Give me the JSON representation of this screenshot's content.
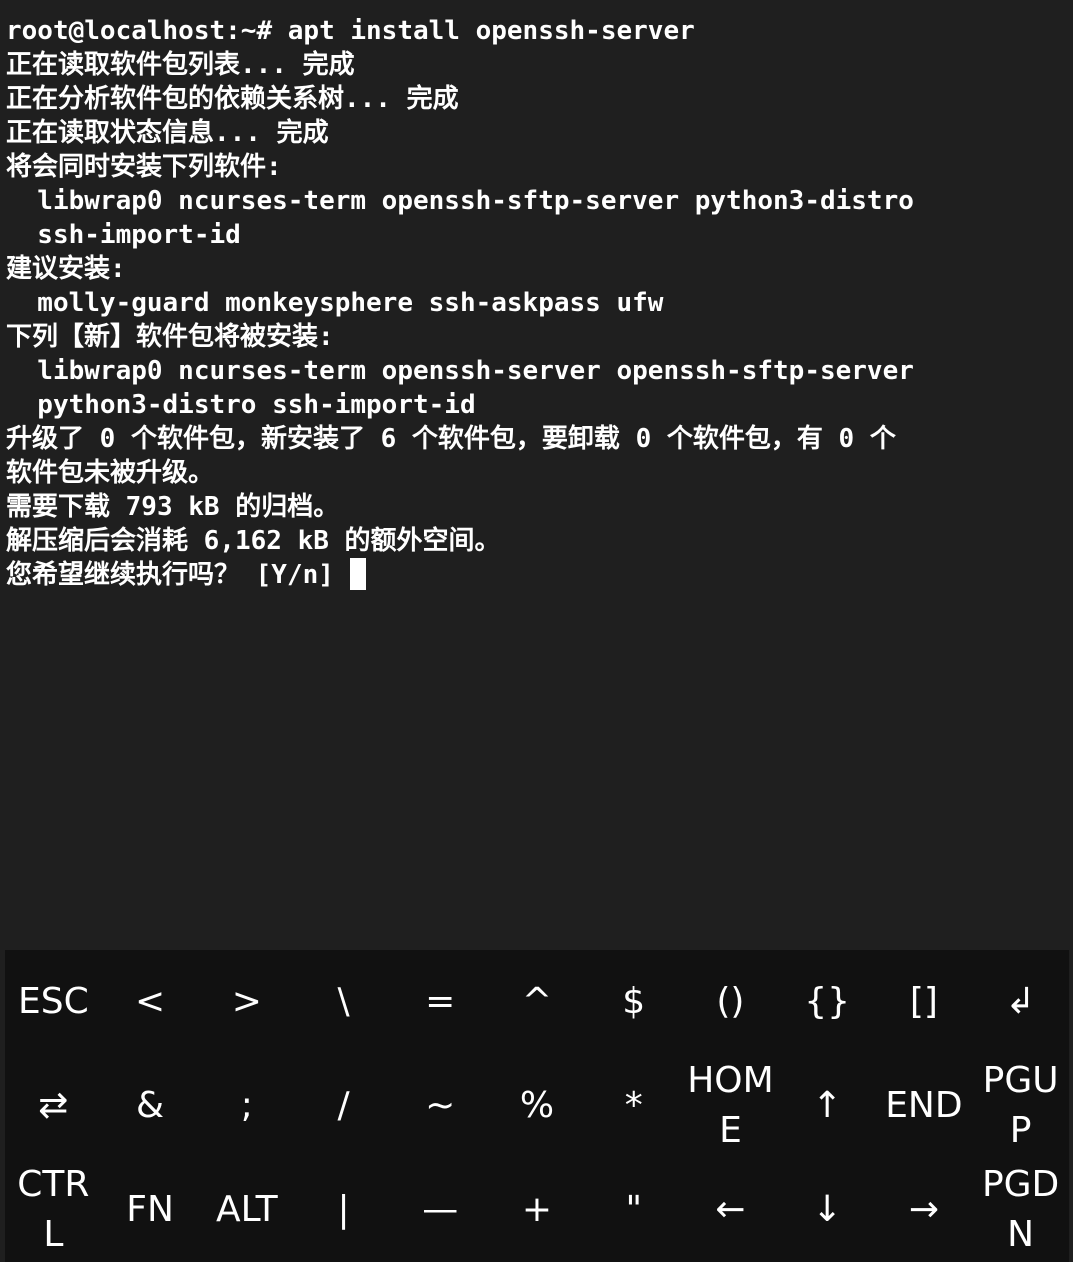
{
  "terminal": {
    "lines": [
      "root@localhost:~# apt install openssh-server",
      "正在读取软件包列表... 完成",
      "正在分析软件包的依赖关系树... 完成",
      "正在读取状态信息... 完成",
      "将会同时安装下列软件:",
      "  libwrap0 ncurses-term openssh-sftp-server python3-distro",
      "  ssh-import-id",
      "建议安装:",
      "  molly-guard monkeysphere ssh-askpass ufw",
      "下列【新】软件包将被安装:",
      "  libwrap0 ncurses-term openssh-server openssh-sftp-server",
      "  python3-distro ssh-import-id",
      "升级了 0 个软件包，新安装了 6 个软件包，要卸载 0 个软件包，有 0 个",
      "软件包未被升级。",
      "需要下载 793 kB 的归档。",
      "解压缩后会消耗 6,162 kB 的额外空间。"
    ],
    "prompt": "您希望继续执行吗？ [Y/n] "
  },
  "keyboard": {
    "rows": [
      [
        {
          "name": "key-esc",
          "label": "ESC"
        },
        {
          "name": "key-less-than",
          "label": "<"
        },
        {
          "name": "key-greater-than",
          "label": ">"
        },
        {
          "name": "key-backslash",
          "label": "\\"
        },
        {
          "name": "key-equals",
          "label": "="
        },
        {
          "name": "key-caret",
          "label": "^"
        },
        {
          "name": "key-dollar",
          "label": "$"
        },
        {
          "name": "key-parentheses",
          "label": "()"
        },
        {
          "name": "key-braces",
          "label": "{}"
        },
        {
          "name": "key-brackets",
          "label": "[]"
        },
        {
          "name": "key-enter",
          "label": "↲"
        }
      ],
      [
        {
          "name": "key-tab",
          "label": "⇄"
        },
        {
          "name": "key-ampersand",
          "label": "&"
        },
        {
          "name": "key-semicolon",
          "label": ";"
        },
        {
          "name": "key-slash",
          "label": "/"
        },
        {
          "name": "key-tilde",
          "label": "~"
        },
        {
          "name": "key-percent",
          "label": "%"
        },
        {
          "name": "key-asterisk",
          "label": "*"
        },
        {
          "name": "key-home",
          "label": "HOME"
        },
        {
          "name": "key-arrow-up",
          "label": "↑"
        },
        {
          "name": "key-end",
          "label": "END"
        },
        {
          "name": "key-page-up",
          "label": "PGUP"
        }
      ],
      [
        {
          "name": "key-ctrl",
          "label": "CTRL"
        },
        {
          "name": "key-fn",
          "label": "FN"
        },
        {
          "name": "key-alt",
          "label": "ALT"
        },
        {
          "name": "key-pipe",
          "label": "|"
        },
        {
          "name": "key-dash",
          "label": "—"
        },
        {
          "name": "key-plus",
          "label": "+"
        },
        {
          "name": "key-double-quote",
          "label": "\""
        },
        {
          "name": "key-arrow-left",
          "label": "←"
        },
        {
          "name": "key-arrow-down",
          "label": "↓"
        },
        {
          "name": "key-arrow-right",
          "label": "→"
        },
        {
          "name": "key-page-down",
          "label": "PGDN"
        }
      ]
    ]
  }
}
